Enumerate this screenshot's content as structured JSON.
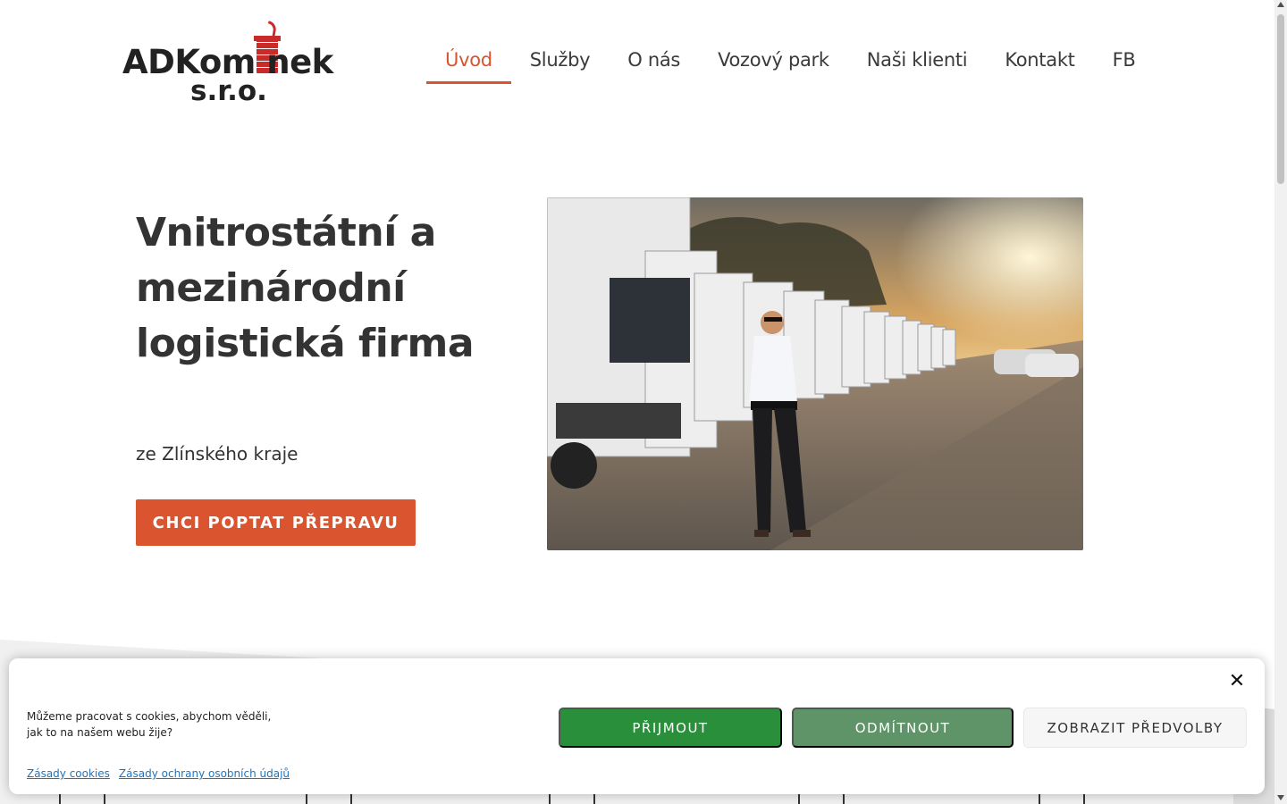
{
  "brand": {
    "logo_line1": "ADKom nek",
    "logo_line2": "s.r.o.",
    "accent_color": "#d9542f",
    "logo_red": "#c92a2a"
  },
  "nav": {
    "items": [
      {
        "label": "Úvod",
        "active": true
      },
      {
        "label": "Služby"
      },
      {
        "label": "O nás"
      },
      {
        "label": "Vozový park"
      },
      {
        "label": "Naši klienti"
      },
      {
        "label": "Kontakt"
      },
      {
        "label": "FB"
      }
    ]
  },
  "hero": {
    "title": "Vnitrostátní a mezinárodní logistická firma",
    "subtitle": "ze Zlínského kraje",
    "cta_label": "CHCI POPTAT PŘEPRAVU"
  },
  "cookie_banner": {
    "message": "Můžeme pracovat s cookies, abychom věděli, jak to na našem webu žije?",
    "accept_label": "PŘIJMOUT",
    "deny_label": "ODMÍTNOUT",
    "prefs_label": "ZOBRAZIT PŘEDVOLBY",
    "links": [
      "Zásady cookies",
      "Zásady ochrany osobních údajů"
    ],
    "accept_color": "#2a8f3a",
    "deny_color": "#5f9468"
  },
  "icons": {
    "close": "close-icon",
    "chimney": "chimney-icon"
  }
}
